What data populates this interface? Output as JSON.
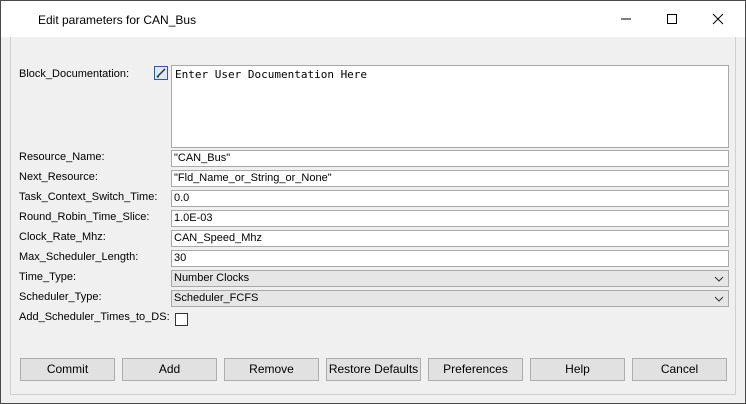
{
  "window": {
    "title": "Edit parameters for CAN_Bus"
  },
  "params": {
    "block_documentation": {
      "label": "Block_Documentation:",
      "value": "Enter User Documentation Here",
      "icon": "edit-doc-icon"
    },
    "resource_name": {
      "label": "Resource_Name:",
      "value": "\"CAN_Bus\""
    },
    "next_resource": {
      "label": "Next_Resource:",
      "value": "\"Fld_Name_or_String_or_None\""
    },
    "task_context_switch_time": {
      "label": "Task_Context_Switch_Time:",
      "value": "0.0"
    },
    "round_robin_time_slice": {
      "label": "Round_Robin_Time_Slice:",
      "value": "1.0E-03"
    },
    "clock_rate_mhz": {
      "label": "Clock_Rate_Mhz:",
      "value": "CAN_Speed_Mhz"
    },
    "max_scheduler_length": {
      "label": "Max_Scheduler_Length:",
      "value": "30"
    },
    "time_type": {
      "label": "Time_Type:",
      "value": "Number Clocks"
    },
    "scheduler_type": {
      "label": "Scheduler_Type:",
      "value": "Scheduler_FCFS"
    },
    "add_scheduler_times_to_ds": {
      "label": "Add_Scheduler_Times_to_DS:",
      "checked": false
    }
  },
  "buttons": {
    "commit": "Commit",
    "add": "Add",
    "remove": "Remove",
    "restore_defaults": "Restore Defaults",
    "preferences": "Preferences",
    "help": "Help",
    "cancel": "Cancel"
  }
}
